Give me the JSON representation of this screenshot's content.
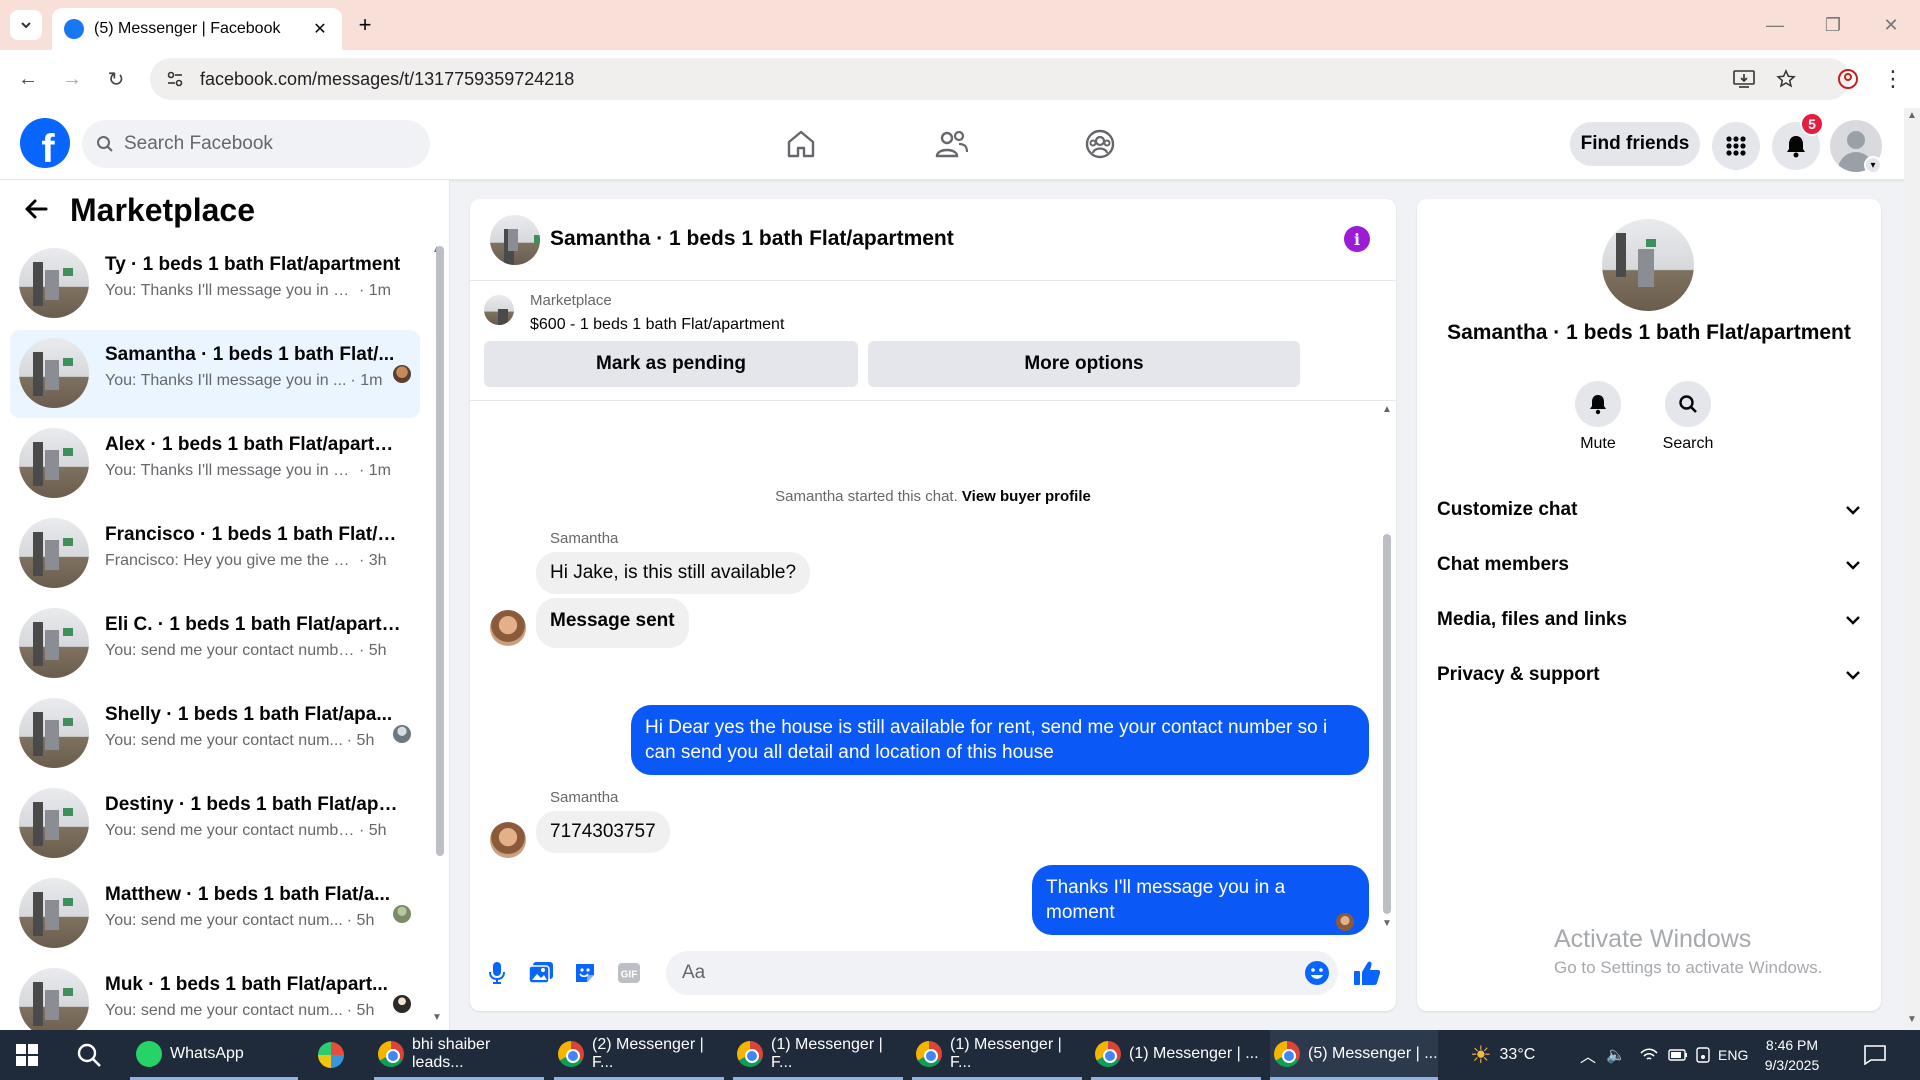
{
  "browser": {
    "tab_title": "(5) Messenger | Facebook",
    "url": "facebook.com/messages/t/1317759359724218"
  },
  "header": {
    "search_placeholder": "Search Facebook",
    "find_friends_label": "Find friends",
    "notification_count": "5"
  },
  "sidebar": {
    "title": "Marketplace",
    "conversations": [
      {
        "name": "Ty · 1 beds 1 bath Flat/apartment",
        "preview": "You: Thanks I'll message you in a ...",
        "time": "· 1m",
        "active": false
      },
      {
        "name": "Samantha · 1 beds 1 bath Flat/...",
        "preview": "You: Thanks I'll message you in ...",
        "time": "· 1m",
        "active": true
      },
      {
        "name": "Alex · 1 beds 1 bath Flat/apartm...",
        "preview": "You: Thanks I'll message you in a ...",
        "time": "· 1m",
        "active": false
      },
      {
        "name": "Francisco · 1 beds 1 bath Flat/ap...",
        "preview": "Francisco: Hey you give me the Det...",
        "time": "· 3h",
        "active": false
      },
      {
        "name": "Eli C. · 1 beds 1 bath Flat/apartm...",
        "preview": "You: send me your contact number...",
        "time": "· 5h",
        "active": false
      },
      {
        "name": "Shelly · 1 beds 1 bath Flat/apa...",
        "preview": "You: send me your contact num...",
        "time": "· 5h",
        "active": false
      },
      {
        "name": "Destiny · 1 beds 1 bath Flat/apar...",
        "preview": "You: send me your contact number...",
        "time": "· 5h",
        "active": false
      },
      {
        "name": "Matthew · 1 beds 1 bath Flat/a...",
        "preview": "You: send me your contact num...",
        "time": "· 5h",
        "active": false
      },
      {
        "name": "Muk · 1 beds 1 bath Flat/apart...",
        "preview": "You: send me your contact num...",
        "time": "· 5h",
        "active": false
      }
    ]
  },
  "chat": {
    "title": "Samantha · 1 beds 1 bath Flat/apartment",
    "listing": {
      "source": "Marketplace",
      "price_title": "$600 - 1 beds 1 bath Flat/apartment"
    },
    "mark_pending_label": "Mark as pending",
    "more_options_label": "More options",
    "system_message": "Samantha started this chat.",
    "view_profile_label": "View buyer profile",
    "messages": [
      {
        "sender": "Samantha",
        "text": "Hi Jake, is this still available?"
      },
      {
        "text": "Message sent"
      },
      {
        "text": "Hi Dear yes the house is still available for rent, send me your contact number so i can send you all detail and location of this house"
      },
      {
        "sender": "Samantha",
        "text": "7174303757"
      },
      {
        "text": "Thanks I'll message you in a moment"
      }
    ],
    "composer_placeholder": "Aa"
  },
  "info_panel": {
    "name": "Samantha · 1 beds 1 bath Flat/apartment",
    "mute_label": "Mute",
    "search_label": "Search",
    "sections": [
      "Customize chat",
      "Chat members",
      "Media, files and links",
      "Privacy & support"
    ],
    "activate_title": "Activate Windows",
    "activate_sub": "Go to Settings to activate Windows."
  },
  "taskbar": {
    "items": [
      "WhatsApp",
      "bhi shaiber leads...",
      "(2) Messenger | F...",
      "(1) Messenger | F...",
      "(1) Messenger | F...",
      "(1) Messenger | ...",
      "(5) Messenger | ..."
    ],
    "weather": "33°C",
    "lang": "ENG",
    "time": "8:46 PM",
    "date": "9/3/2025"
  },
  "colors": {
    "accent": "#0866ff",
    "outgoing_bubble": "#0a58f5",
    "info_icon": "#9b1bd6",
    "badge": "#e41e3f"
  }
}
